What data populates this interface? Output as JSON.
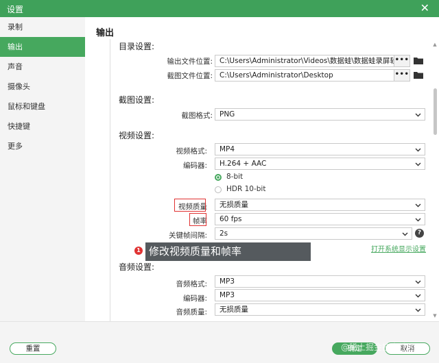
{
  "window": {
    "title": "设置",
    "close_glyph": "✕"
  },
  "sidebar": {
    "items": [
      {
        "label": "录制",
        "active": false
      },
      {
        "label": "输出",
        "active": true
      },
      {
        "label": "声音",
        "active": false
      },
      {
        "label": "摄像头",
        "active": false
      },
      {
        "label": "鼠标和键盘",
        "active": false
      },
      {
        "label": "快捷键",
        "active": false
      },
      {
        "label": "更多",
        "active": false
      }
    ]
  },
  "main": {
    "section_title": "输出",
    "directory": {
      "heading": "目录设置:",
      "output_label": "输出文件位置:",
      "output_value": "C:\\Users\\Administrator\\Videos\\数据蛙\\数据蛙录屏软件",
      "screenshot_label": "截图文件位置:",
      "screenshot_value": "C:\\Users\\Administrator\\Desktop",
      "browse_label": "•••"
    },
    "screenshot": {
      "heading": "截图设置:",
      "format_label": "截图格式:",
      "format_value": "PNG"
    },
    "video": {
      "heading": "视频设置:",
      "format_label": "视频格式:",
      "format_value": "MP4",
      "encoder_label": "编码器:",
      "encoder_value": "H.264 + AAC",
      "bit_8_label": "8-bit",
      "hdr_label": "HDR 10-bit",
      "quality_label": "视频质量",
      "quality_value": "无损质量",
      "fps_label": "帧率",
      "fps_value": "60 fps",
      "keyframe_label": "关键帧间隔:",
      "keyframe_value": "2s",
      "help_glyph": "?",
      "display_settings_link": "打开系统显示设置"
    },
    "tooltip": {
      "badge": "1",
      "text": "修改视频质量和帧率"
    },
    "audio": {
      "heading": "音频设置:",
      "format_label": "音频格式:",
      "format_value": "MP3",
      "encoder_label": "编码器:",
      "encoder_value": "MP3",
      "quality_label": "音频质量:",
      "quality_value": "无损质量"
    }
  },
  "footer": {
    "reset_label": "重置",
    "ok_label": "确定",
    "cancel_label": "取消",
    "watermark": "@稀土掘金技术社区"
  },
  "colors": {
    "accent": "#46a85e",
    "titlebar": "#3fa15a",
    "highlight_box": "#e03030",
    "tooltip_bg": "#555a5e"
  }
}
